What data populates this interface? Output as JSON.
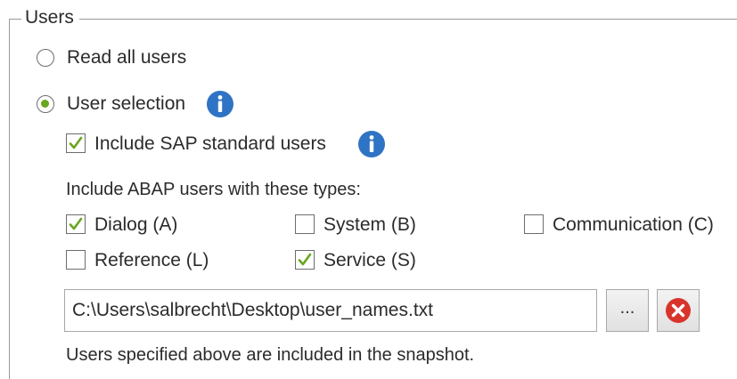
{
  "group": {
    "title": "Users"
  },
  "options": {
    "read_all_label": "Read all users",
    "read_all_selected": false,
    "user_selection_label": "User selection",
    "user_selection_selected": true
  },
  "include_standard": {
    "label": "Include SAP standard users",
    "checked": true
  },
  "abap_types": {
    "heading": "Include ABAP users with these types:",
    "items": [
      {
        "label": "Dialog (A)",
        "checked": true
      },
      {
        "label": "System (B)",
        "checked": false
      },
      {
        "label": "Communication (C)",
        "checked": false
      },
      {
        "label": "Reference (L)",
        "checked": false
      },
      {
        "label": "Service (S)",
        "checked": true
      }
    ]
  },
  "file": {
    "path": "C:\\Users\\salbrecht\\Desktop\\user_names.txt",
    "browse_label": "...",
    "clear_icon": "clear-x-icon"
  },
  "footer": {
    "note": "Users specified above are included in the snapshot."
  },
  "colors": {
    "accent_green": "#6aa61f",
    "info_blue": "#2f73c4",
    "clear_red": "#d9342b"
  }
}
